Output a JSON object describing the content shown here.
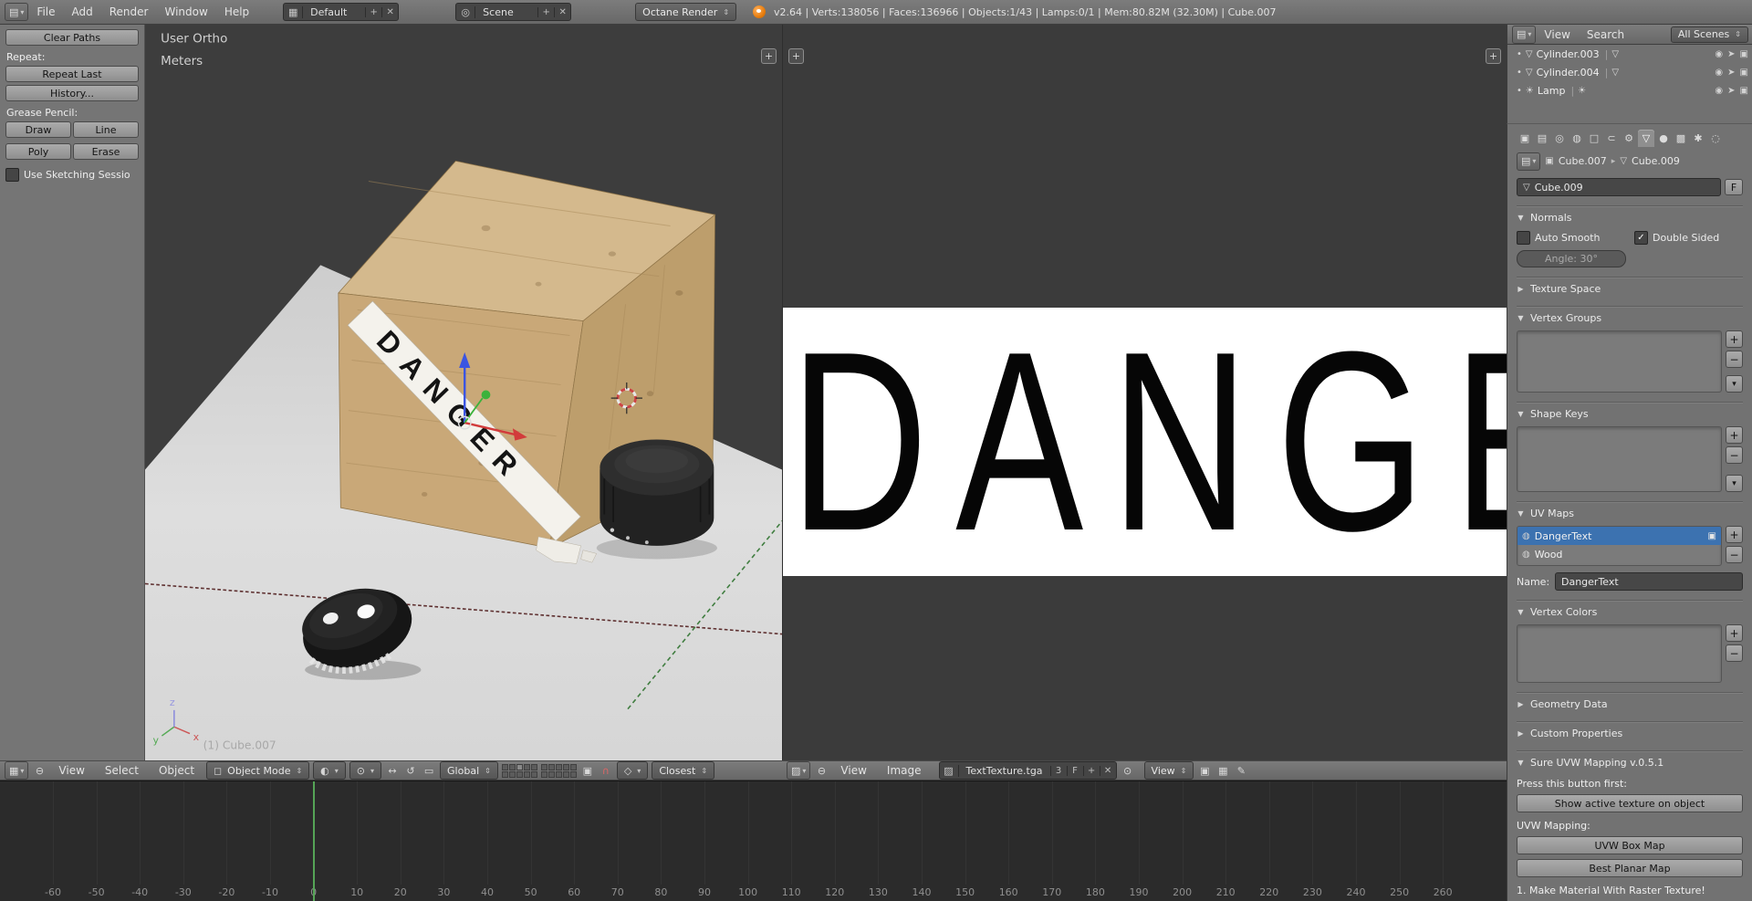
{
  "icons": {
    "editor_menu": "▤",
    "grid": "▦",
    "collapse": "⊖",
    "arrow_down": "▾",
    "plus": "+",
    "close": "✕",
    "updown": "⇕",
    "scene": "◎",
    "mode_cube": "◻",
    "shading": "◐",
    "pivot": "⊙",
    "manip_move": "↔",
    "manip_rot": "↺",
    "manip_scale": "▭",
    "lock": "▣",
    "magnet": "∩",
    "snap_el": "◇",
    "pin": "⊙",
    "image": "▨",
    "mesh_data": "▽",
    "object": "▣",
    "eye": "◉",
    "select": "➤",
    "camera": "▣",
    "lamp": "☀",
    "texture_ball": "◍",
    "check": "✓",
    "tri_open": "▼",
    "tri_closed": "▶",
    "minus": "−",
    "crumb": "▸",
    "pencil": "✎",
    "layers": "▦"
  },
  "top_header": {
    "menus": [
      "File",
      "Add",
      "Render",
      "Window",
      "Help"
    ],
    "layout_name": "Default",
    "scene_name": "Scene",
    "engine": "Octane Render",
    "stats": "v2.64 | Verts:138056 | Faces:136966 | Objects:1/43 | Lamps:0/1 | Mem:80.82M (32.30M) | Cube.007"
  },
  "tool_shelf": {
    "clear_paths": "Clear Paths",
    "repeat_label": "Repeat:",
    "repeat_last": "Repeat Last",
    "history": "History...",
    "grease_label": "Grease Pencil:",
    "draw": "Draw",
    "line": "Line",
    "poly": "Poly",
    "erase": "Erase",
    "sketch_label": "Use Sketching Sessio"
  },
  "viewport": {
    "view_mode": "User Ortho",
    "units": "Meters",
    "active_object": "(1) Cube.007",
    "banner_text": "DANGER",
    "axis_x": "x",
    "axis_y": "y",
    "axis_z": "z"
  },
  "viewport_header": {
    "menus": [
      "View",
      "Select",
      "Object"
    ],
    "mode": "Object Mode",
    "orientation": "Global",
    "snap_mode": "Closest"
  },
  "uv_editor": {
    "texture_visible_text": "DANGE",
    "menus": [
      "View",
      "Image"
    ],
    "image_name": "TextTexture.tga",
    "users_count": "3",
    "fake_user": "F",
    "view_mode": "View"
  },
  "timeline": {
    "frame_labels": [
      -60,
      -50,
      -40,
      -30,
      -20,
      -10,
      0,
      10,
      20,
      30,
      40,
      50,
      60,
      70,
      80,
      90,
      100,
      110,
      120,
      130,
      140,
      150,
      160,
      170,
      180,
      190,
      200,
      210,
      220,
      230,
      240,
      250,
      260
    ],
    "current_frame": 0,
    "playhead_color": "#55a456"
  },
  "outliner": {
    "menus": [
      "View",
      "Search"
    ],
    "scene_filter": "All Scenes",
    "items": [
      {
        "name": "Cylinder.003",
        "type": "mesh"
      },
      {
        "name": "Cylinder.004",
        "type": "mesh"
      },
      {
        "name": "Lamp",
        "type": "lamp"
      }
    ]
  },
  "properties": {
    "tabs": [
      {
        "id": "render",
        "glyph": "▣"
      },
      {
        "id": "render-layers",
        "glyph": "▤"
      },
      {
        "id": "scene",
        "glyph": "◎"
      },
      {
        "id": "world",
        "glyph": "◍"
      },
      {
        "id": "object",
        "glyph": "□"
      },
      {
        "id": "constraints",
        "glyph": "⊂"
      },
      {
        "id": "modifiers",
        "glyph": "⚙"
      },
      {
        "id": "data",
        "glyph": "▽"
      },
      {
        "id": "material",
        "glyph": "●"
      },
      {
        "id": "texture",
        "glyph": "▩"
      },
      {
        "id": "particles",
        "glyph": "✱"
      },
      {
        "id": "physics",
        "glyph": "◌"
      }
    ],
    "active_tab": "data",
    "breadcrumb": {
      "object": "Cube.007",
      "data": "Cube.009"
    },
    "name_value": "Cube.009",
    "fake_user": "F",
    "normals": {
      "title": "Normals",
      "auto_smooth": "Auto Smooth",
      "double_sided": "Double Sided",
      "angle": "Angle: 30°"
    },
    "texture_space_title": "Texture Space",
    "vertex_groups_title": "Vertex Groups",
    "shape_keys_title": "Shape Keys",
    "uv_maps": {
      "title": "UV Maps",
      "items": [
        "DangerText",
        "Wood"
      ],
      "name_label": "Name:",
      "name_value": "DangerText",
      "selected_color": "#3c72b0"
    },
    "vertex_colors_title": "Vertex Colors",
    "geometry_data_title": "Geometry Data",
    "custom_props_title": "Custom Properties",
    "uvw": {
      "title": "Sure UVW Mapping v.0.5.1",
      "hint": "Press this button first:",
      "show_btn": "Show active texture on object",
      "mapping_label": "UVW Mapping:",
      "box_btn": "UVW Box Map",
      "planar_btn": "Best Planar Map",
      "note": "1. Make Material With Raster Texture!"
    }
  }
}
